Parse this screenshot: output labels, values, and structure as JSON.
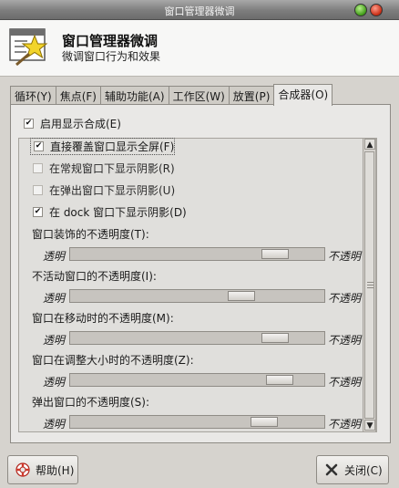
{
  "window": {
    "title": "窗口管理器微调"
  },
  "header": {
    "title": "窗口管理器微调",
    "subtitle": "微调窗口行为和效果",
    "icon": "window-star-icon"
  },
  "tabs": [
    {
      "label": "循环(Y)",
      "active": false
    },
    {
      "label": "焦点(F)",
      "active": false
    },
    {
      "label": "辅助功能(A)",
      "active": false
    },
    {
      "label": "工作区(W)",
      "active": false
    },
    {
      "label": "放置(P)",
      "active": false
    },
    {
      "label": "合成器(O)",
      "active": true
    }
  ],
  "compositor": {
    "enable": {
      "label": "启用显示合成(E)",
      "checked": true
    },
    "options": [
      {
        "label": "直接覆盖窗口显示全屏(F)",
        "checked": true,
        "enabled": true
      },
      {
        "label": "在常规窗口下显示阴影(R)",
        "checked": false,
        "enabled": false
      },
      {
        "label": "在弹出窗口下显示阴影(U)",
        "checked": false,
        "enabled": false
      },
      {
        "label": "在 dock 窗口下显示阴影(D)",
        "checked": true,
        "enabled": true
      }
    ],
    "opacity": [
      {
        "label": "窗口装饰的不透明度(T):",
        "low": "透明",
        "high": "不透明",
        "value": 0.85
      },
      {
        "label": "不活动窗口的不透明度(I):",
        "low": "透明",
        "high": "不透明",
        "value": 0.7
      },
      {
        "label": "窗口在移动时的不透明度(M):",
        "low": "透明",
        "high": "不透明",
        "value": 0.85
      },
      {
        "label": "窗口在调整大小时的不透明度(Z):",
        "low": "透明",
        "high": "不透明",
        "value": 0.87
      },
      {
        "label": "弹出窗口的不透明度(S):",
        "low": "透明",
        "high": "不透明",
        "value": 0.8
      }
    ]
  },
  "buttons": {
    "help": "帮助(H)",
    "close": "关闭(C)"
  }
}
